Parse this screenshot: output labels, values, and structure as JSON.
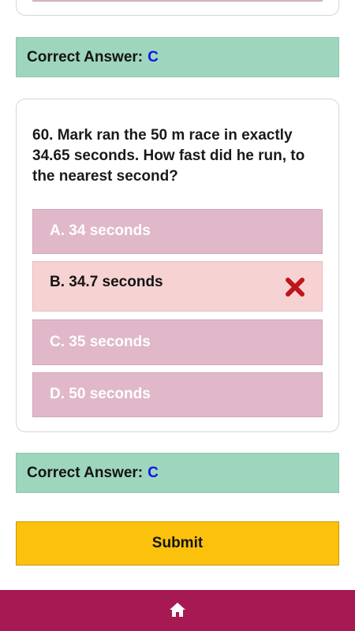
{
  "answer_top": {
    "label": "Correct Answer:",
    "letter": "C"
  },
  "question": {
    "text": "60. Mark ran the 50 m race in exactly 34.65 seconds. How fast did he run, to the nearest second?",
    "options": [
      {
        "label": "A. 34 seconds",
        "state": "unselected"
      },
      {
        "label": "B. 34.7 seconds",
        "state": "wrong"
      },
      {
        "label": "C. 35 seconds",
        "state": "unselected"
      },
      {
        "label": "D. 50 seconds",
        "state": "unselected"
      }
    ]
  },
  "answer_bottom": {
    "label": "Correct Answer:",
    "letter": "C"
  },
  "submit": {
    "label": "Submit"
  },
  "nav": {
    "home_icon": "home-icon"
  },
  "colors": {
    "answer_bar": "#9ed6bd",
    "answer_letter": "#1212ee",
    "option": "#e0b8c9",
    "option_wrong": "#f6d2d3",
    "wrong_mark": "#c0141b",
    "submit": "#fcc10c",
    "bottom_nav": "#a61953"
  }
}
